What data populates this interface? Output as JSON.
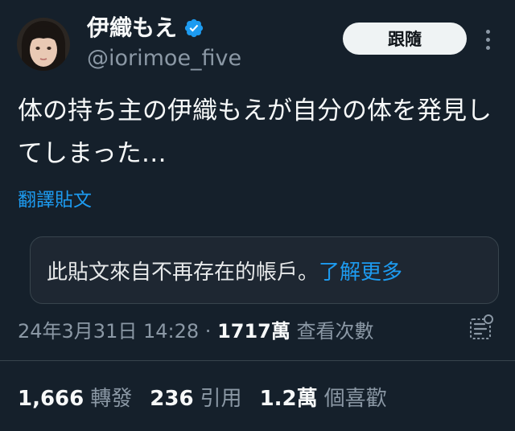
{
  "author": {
    "display_name": "伊織もえ",
    "handle": "@iorimoe_five",
    "verified_icon": "verified-badge-icon",
    "verified_color": "#1d9bf0"
  },
  "follow_button": {
    "label": "跟隨"
  },
  "tweet": {
    "text": "体の持ち主の伊織もえが自分の体を発見してしまった…",
    "translate_label": "翻譯貼文"
  },
  "notice": {
    "text": "此貼文來自不再存在的帳戶。",
    "link_label": "了解更多"
  },
  "meta": {
    "timestamp": "24年3月31日 14:28",
    "separator": "·",
    "views_count": "1717萬",
    "views_label": "查看次數"
  },
  "stats": {
    "retweets_count": "1,666",
    "retweets_label": "轉發",
    "quotes_count": "236",
    "quotes_label": "引用",
    "likes_count": "1.2萬",
    "likes_label": "個喜歡"
  },
  "colors": {
    "background": "#15202b",
    "text_primary": "#f7f9f9",
    "text_secondary": "#8b98a5",
    "link": "#1d9bf0",
    "border": "#38444d"
  }
}
